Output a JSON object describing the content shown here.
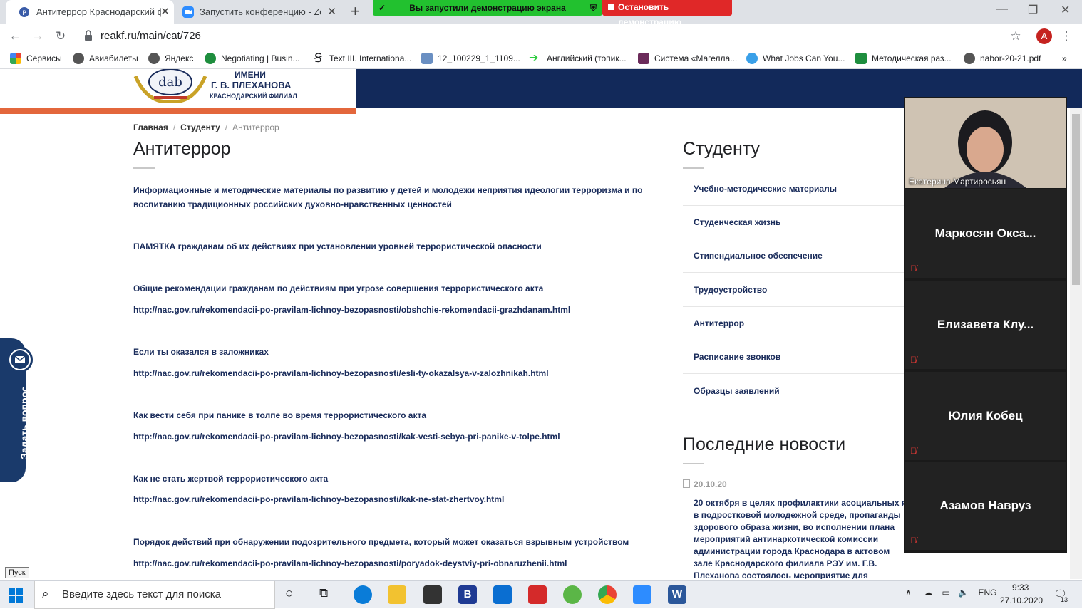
{
  "tabs": [
    {
      "title": "Антитеррор Краснодарский фи",
      "active": true
    },
    {
      "title": "Запустить конференцию - Zoom",
      "active": false
    }
  ],
  "screen_share": {
    "status": "Вы запустили демонстрацию экрана",
    "stop": "Остановить демонстрацию"
  },
  "toolbar": {
    "url": "reakf.ru/main/cat/726",
    "avatar": "A"
  },
  "bookmarks": [
    "Сервисы",
    "Авиабилеты",
    "Яндекс",
    "Negotiating | Busin...",
    "Text III. Internationa...",
    "12_100229_1_1109...",
    "Английский (топик...",
    "Система «Магелла...",
    "What Jobs Can You...",
    "Методическая раз...",
    "nabor-20-21.pdf"
  ],
  "header": {
    "logo_line1": "ИМЕНИ",
    "logo_line2": "Г. В. ПЛЕХАНОВА",
    "logo_line3": "КРАСНОДАРСКИЙ ФИЛИАЛ"
  },
  "breadcrumb": {
    "home": "Главная",
    "section": "Студенту",
    "current": "Антитеррор"
  },
  "main": {
    "title": "Антитеррор",
    "items": [
      "Информационные и методические материалы по развитию у детей и молодежи неприятия идеологии терроризма и по воспитанию традиционных российских духовно-нравственных ценностей",
      "ПАМЯТКА гражданам об их действиях при установлении уровней террористической опасности",
      "Общие рекомендации гражданам по действиям при угрозе совершения террористического акта",
      "http://nac.gov.ru/rekomendacii-po-pravilam-lichnoy-bezopasnosti/obshchie-rekomendacii-grazhdanam.html",
      "Если ты оказался в заложниках",
      "http://nac.gov.ru/rekomendacii-po-pravilam-lichnoy-bezopasnosti/esli-ty-okazalsya-v-zalozhnikah.html",
      "Как вести себя при панике в толпе во время террористического акта",
      "http://nac.gov.ru/rekomendacii-po-pravilam-lichnoy-bezopasnosti/kak-vesti-sebya-pri-panike-v-tolpe.html",
      "Как не стать жертвой террористического акта",
      "http://nac.gov.ru/rekomendacii-po-pravilam-lichnoy-bezopasnosti/kak-ne-stat-zhertvoy.html",
      "Порядок действий при обнаружении подозрительного предмета, который может оказаться взрывным устройством",
      "http://nac.gov.ru/rekomendacii-po-pravilam-lichnoy-bezopasnosti/poryadok-deystviy-pri-obnaruzhenii.html"
    ]
  },
  "sidebar": {
    "title": "Студенту",
    "items": [
      "Учебно-методические материалы",
      "Студенческая жизнь",
      "Стипендиальное обеспечение",
      "Трудоустройство",
      "Антитеррор",
      "Расписание звонков",
      "Образцы заявлений"
    ],
    "news_title": "Последние новости",
    "news_date": "20.10.20",
    "news_text": "20 октября в целях профилактики асоциальных я в подростковой молодежной среде, пропаганды здорового образа жизни, во исполнении плана мероприятий антинаркотической комиссии администрации города Краснодара в актовом зале Краснодарского филиала РЭУ им. Г.В. Плеханова состоялось мероприятие для обучающихся"
  },
  "ask_question": "Задать вопрос",
  "zoom_participants": {
    "video": "Екатерина Мартиросьян",
    "others": [
      "Маркосян Окса...",
      "Елизавета Клу...",
      "Юлия Кобец",
      "Азамов Навруз"
    ]
  },
  "tooltip": "Пуск",
  "taskbar": {
    "search_placeholder": "Введите здесь текст для поиска",
    "lang": "ENG",
    "time": "9:33",
    "date": "27.10.2020",
    "notifications": "13"
  },
  "colors": {
    "navy": "#1a2c5b",
    "header_blue": "#12295a",
    "accent_orange": "#e3673c",
    "share_green": "#22c12f",
    "share_red": "#e02828"
  }
}
